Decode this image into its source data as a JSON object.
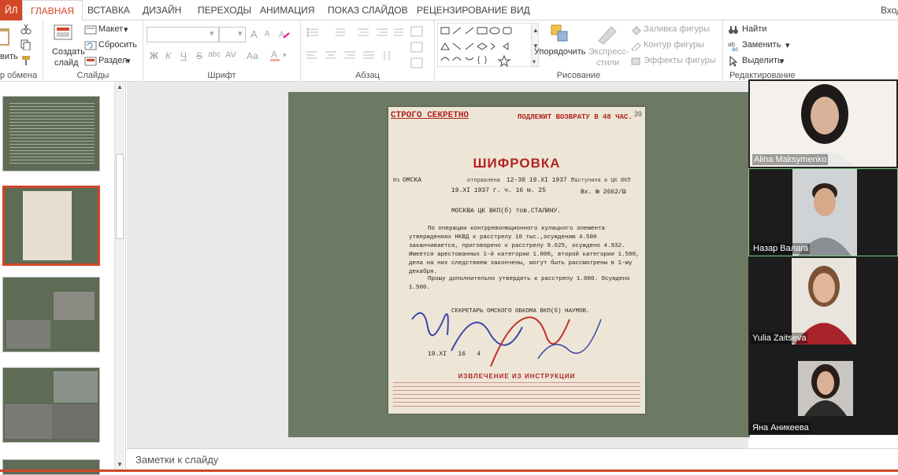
{
  "tabs": {
    "file": "ЙЛ",
    "home": "ГЛАВНАЯ",
    "insert": "ВСТАВКА",
    "design": "ДИЗАЙН",
    "transitions": "ПЕРЕХОДЫ",
    "animation": "АНИМАЦИЯ",
    "slideshow": "ПОКАЗ СЛАЙДОВ",
    "review": "РЕЦЕНЗИРОВАНИЕ",
    "view": "ВИД",
    "signin": "Вход"
  },
  "ribbon": {
    "clipboard": {
      "paste": "вить",
      "label": "р обмена"
    },
    "slides": {
      "create": "Создать",
      "create2": "слайд",
      "layout": "Макет",
      "reset": "Сбросить",
      "section": "Раздел",
      "label": "Слайды"
    },
    "font": {
      "label": "Шрифт",
      "bold": "Ж",
      "italic": "К",
      "underline": "Ч",
      "strike": "S",
      "shadow": "abc",
      "spacing": "AV",
      "case": "Aa",
      "grow": "A",
      "shrink": "A"
    },
    "paragraph": {
      "label": "Абзац"
    },
    "drawing": {
      "arrange": "Упорядочить",
      "styles": "Экспресс-",
      "styles2": "стили",
      "fill": "Заливка фигуры",
      "outline": "Контур фигуры",
      "effects": "Эффекты фигуры",
      "label": "Рисование"
    },
    "editing": {
      "find": "Найти",
      "replace": "Заменить",
      "select": "Выделить",
      "label": "Редактирование"
    }
  },
  "doc": {
    "top_secret": "СТРОГО СЕКРЕТНО",
    "return": "ПОДЛЕЖИТ ВОЗВРАТУ В 48 ЧАС.",
    "page_no": "39",
    "title": "ШИФРОВКА",
    "from_label": "Из",
    "from": "ОМСКА",
    "sent_label": "отправлена",
    "sent": "12-30   19.XI 1937 г.",
    "received_label": "Поступила в ЦК ВКП",
    "decoded": "19.XI 1937 г. ч. 16 м. 25",
    "in_no": "Вх. № 2662/Ш",
    "to": "МОСКВА ЦК ВКП(б) тов.СТАЛИНУ.",
    "body": "По операции контрреволюционного кулацкого элемента утверждениях НКВД к расстрелу 10 тыс.,осуждению 4.500 заканчивается, приговорено к расстрелу 9.625, осуждено 4.932. Имеется арестованных 1-й категории 1.000, второй категории 1.500, дела на них следствием закончены, могут быть рассмотрены в 1-му декабря.",
    "body2": "Прошу дополнительно утвердить к расстрелу 1.000. Осуждено 1.500.",
    "signature": "СЕКРЕТАРЬ ОМСКОГО ОБКОМА ВКП(б) НАУМОВ.",
    "date_line": "19.XI   16   4",
    "instructions": "ИЗВЛЕЧЕНИЕ ИЗ ИНСТРУКЦИИ"
  },
  "notes": {
    "placeholder": "Заметки к слайду"
  },
  "participants": [
    {
      "name": "Alina Maksymenko"
    },
    {
      "name": "Назар Валага"
    },
    {
      "name": "Yulia Zaitseva"
    },
    {
      "name": "Яна Аникеева"
    }
  ],
  "colors": {
    "accent": "#d24726",
    "doc_red": "#b22222"
  }
}
